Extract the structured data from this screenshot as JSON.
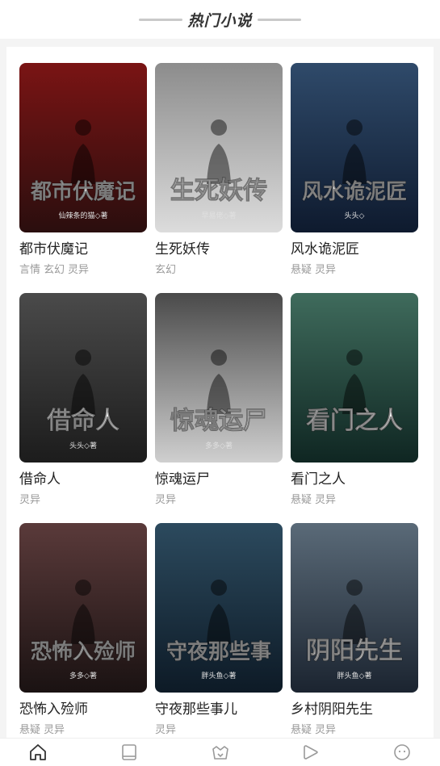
{
  "header": {
    "title": "热门小说"
  },
  "books": [
    {
      "title": "都市伏魔记",
      "tags": [
        "言情",
        "玄幻",
        "灵异"
      ],
      "cover_text": "都市伏魔记",
      "cover_author": "仙辣条的猫◇著",
      "colors": [
        "#2a0e0e",
        "#7a1414"
      ]
    },
    {
      "title": "生死妖传",
      "tags": [
        "玄幻"
      ],
      "cover_text": "生死妖传",
      "cover_author": "早易佬◇著",
      "colors": [
        "#dcdcdc",
        "#8c8c8c"
      ]
    },
    {
      "title": "风水诡泥匠",
      "tags": [
        "悬疑",
        "灵异"
      ],
      "cover_text": "风水诡泥匠",
      "cover_author": "头头◇",
      "colors": [
        "#0e1a2e",
        "#2f4a6a"
      ]
    },
    {
      "title": "借命人",
      "tags": [
        "灵异"
      ],
      "cover_text": "借命人",
      "cover_author": "头头◇著",
      "colors": [
        "#1c1c1c",
        "#4a4a4a"
      ]
    },
    {
      "title": "惊魂运尸",
      "tags": [
        "灵异"
      ],
      "cover_text": "惊魂运尸",
      "cover_author": "多多◇著",
      "colors": [
        "#cfcfcf",
        "#4a4a4a"
      ]
    },
    {
      "title": "看门之人",
      "tags": [
        "悬疑",
        "灵异"
      ],
      "cover_text": "看门之人",
      "cover_author": "",
      "colors": [
        "#0f2622",
        "#3f6b5c"
      ]
    },
    {
      "title": "恐怖入殓师",
      "tags": [
        "悬疑",
        "灵异"
      ],
      "cover_text": "恐怖入殓师",
      "cover_author": "多多◇著",
      "colors": [
        "#1a1212",
        "#5a3a3a"
      ]
    },
    {
      "title": "守夜那些事儿",
      "tags": [
        "灵异"
      ],
      "cover_text": "守夜那些事",
      "cover_author": "胖头鱼◇著",
      "colors": [
        "#0d1a26",
        "#2c4a5e"
      ]
    },
    {
      "title": "乡村阴阳先生",
      "tags": [
        "悬疑",
        "灵异"
      ],
      "cover_text": "阴阳先生",
      "cover_author": "胖头鱼◇著",
      "colors": [
        "#1b2430",
        "#5a6a78"
      ]
    }
  ],
  "tabbar": {
    "items": [
      {
        "icon": "home-icon",
        "active": true
      },
      {
        "icon": "book-icon",
        "active": false
      },
      {
        "icon": "basket-icon",
        "active": false
      },
      {
        "icon": "play-icon",
        "active": false
      },
      {
        "icon": "face-icon",
        "active": false
      }
    ]
  }
}
